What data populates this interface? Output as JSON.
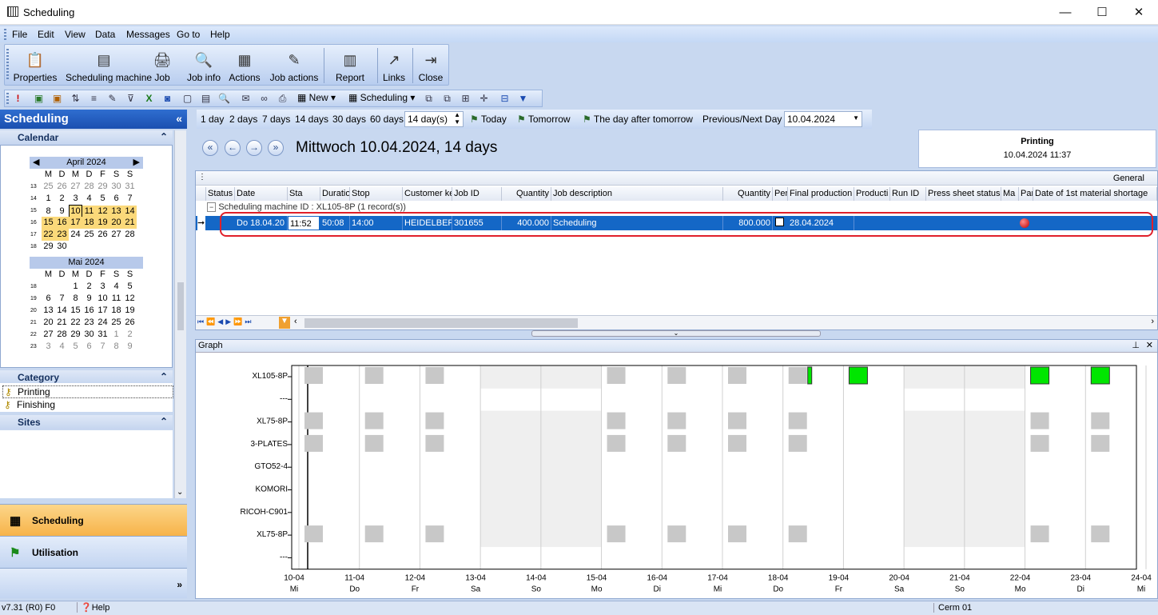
{
  "window": {
    "title": "Scheduling",
    "controls": [
      "—",
      "☐",
      "✕"
    ]
  },
  "menu": [
    "File",
    "Edit",
    "View",
    "Data",
    "Messages",
    "Go to",
    "Help"
  ],
  "bigtoolbar": [
    {
      "label": "Properties",
      "icon": "properties-icon",
      "glyph": "📋"
    },
    {
      "label": "Scheduling machine",
      "icon": "machine-icon",
      "glyph": "▤"
    },
    {
      "label": "Job",
      "icon": "job-icon",
      "glyph": "🖨"
    },
    {
      "label": "Job info",
      "icon": "job-info-icon",
      "glyph": "🔍"
    },
    {
      "label": "Actions",
      "icon": "actions-icon",
      "glyph": "▦"
    },
    {
      "label": "Job actions",
      "icon": "job-actions-icon",
      "glyph": "✎"
    },
    {
      "label": "Report",
      "icon": "report-icon",
      "glyph": "▥"
    },
    {
      "label": "Links",
      "icon": "links-icon",
      "glyph": "↗"
    },
    {
      "label": "Close",
      "icon": "close-icon",
      "glyph": "⇥"
    }
  ],
  "smalltoolbar": {
    "new_label": "New",
    "scheduling_label": "Scheduling"
  },
  "left": {
    "title": "Scheduling",
    "calendar_label": "Calendar",
    "april": {
      "title": "April 2024",
      "days": [
        "M",
        "D",
        "M",
        "D",
        "F",
        "S",
        "S"
      ],
      "weeks": [
        {
          "wk": "13",
          "d": [
            "25",
            "26",
            "27",
            "28",
            "29",
            "30",
            "31"
          ]
        },
        {
          "wk": "14",
          "d": [
            "1",
            "2",
            "3",
            "4",
            "5",
            "6",
            "7"
          ]
        },
        {
          "wk": "15",
          "d": [
            "8",
            "9",
            "10",
            "11",
            "12",
            "13",
            "14"
          ]
        },
        {
          "wk": "16",
          "d": [
            "15",
            "16",
            "17",
            "18",
            "19",
            "20",
            "21"
          ]
        },
        {
          "wk": "17",
          "d": [
            "22",
            "23",
            "24",
            "25",
            "26",
            "27",
            "28"
          ]
        },
        {
          "wk": "18",
          "d": [
            "29",
            "30",
            "",
            "",
            "",
            "",
            ""
          ]
        }
      ]
    },
    "mai": {
      "title": "Mai 2024",
      "days": [
        "M",
        "D",
        "M",
        "D",
        "F",
        "S",
        "S"
      ],
      "weeks": [
        {
          "wk": "18",
          "d": [
            "",
            "",
            "1",
            "2",
            "3",
            "4",
            "5"
          ]
        },
        {
          "wk": "19",
          "d": [
            "6",
            "7",
            "8",
            "9",
            "10",
            "11",
            "12"
          ]
        },
        {
          "wk": "20",
          "d": [
            "13",
            "14",
            "15",
            "16",
            "17",
            "18",
            "19"
          ]
        },
        {
          "wk": "21",
          "d": [
            "20",
            "21",
            "22",
            "23",
            "24",
            "25",
            "26"
          ]
        },
        {
          "wk": "22",
          "d": [
            "27",
            "28",
            "29",
            "30",
            "31",
            "1",
            "2"
          ]
        },
        {
          "wk": "23",
          "d": [
            "3",
            "4",
            "5",
            "6",
            "7",
            "8",
            "9"
          ]
        }
      ]
    },
    "category_label": "Category",
    "categories": [
      "Printing",
      "Finishing"
    ],
    "sites_label": "Sites",
    "nav": [
      "Scheduling",
      "Utilisation"
    ],
    "more": "»"
  },
  "daybar": {
    "ranges": [
      "1 day",
      "2 days",
      "7 days",
      "14 days",
      "30 days",
      "60 days"
    ],
    "spin_value": "14 day(s)",
    "today": "Today",
    "tomorrow": "Tomorrow",
    "after": "The day after tomorrow",
    "prevnext": "Previous/Next Day",
    "date_value": "10.04.2024"
  },
  "header": {
    "title": "Mittwoch 10.04.2024, 14 days",
    "printing_label": "Printing",
    "printing_time": "10.04.2024 11:37"
  },
  "grid": {
    "general": "General",
    "columns": [
      "Status",
      "Date",
      "Sta",
      "Duratio",
      "Stop",
      "Customer ke",
      "Job ID",
      "Quantity",
      "Job description",
      "Quantity",
      "Per",
      "Final production",
      "Producti",
      "Run ID",
      "Press sheet status",
      "Ma",
      "Par",
      "Date of 1st material shortage"
    ],
    "group": "Scheduling machine ID : XL105-8P (1 record(s))",
    "row": {
      "date": "Do 18.04.20",
      "start": "11:52",
      "duration": "50:08",
      "stop": "14:00",
      "customer": "HEIDELBERG",
      "job_id": "301655",
      "quantity": "400.000",
      "description": "Scheduling",
      "quantity2": "800.000",
      "final": "28.04.2024"
    }
  },
  "graph": {
    "title": "Graph",
    "rows": [
      "XL105-8P",
      "---",
      "XL75-8P",
      "3-PLATES",
      "GTO52-4",
      "KOMORI",
      "RICOH-C901",
      "XL75-8P",
      "---"
    ],
    "dates": [
      "10-04",
      "11-04",
      "12-04",
      "13-04",
      "14-04",
      "15-04",
      "16-04",
      "17-04",
      "18-04",
      "19-04",
      "20-04",
      "21-04",
      "22-04",
      "23-04",
      "24-04"
    ],
    "weekdays": [
      "Mi",
      "Do",
      "Fr",
      "Sa",
      "So",
      "Mo",
      "Di",
      "Mi",
      "Do",
      "Fr",
      "Sa",
      "So",
      "Mo",
      "Di",
      "Mi"
    ],
    "colors": {
      "job": "#00e600",
      "booked": "#c8c8c8",
      "weekend": "#efefef"
    }
  },
  "status": {
    "version": "v7.31 (R0) F0",
    "help": "Help",
    "user": "Cerm 01"
  }
}
